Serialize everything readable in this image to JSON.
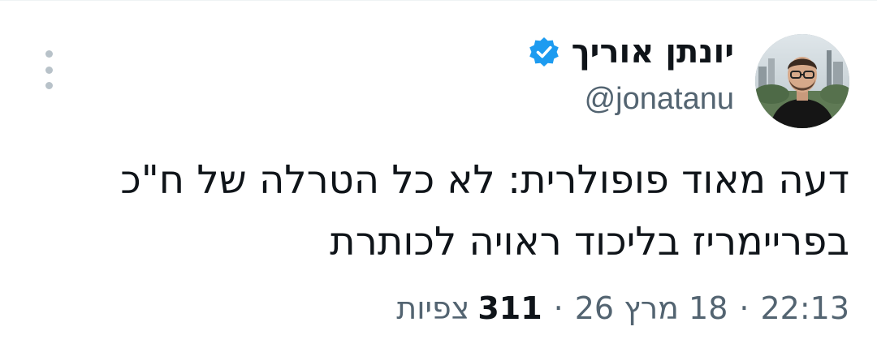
{
  "tweet": {
    "author": {
      "display_name": "יונתן אוריך",
      "handle": "@jonatanu",
      "verified": true,
      "verified_icon": "verified-badge-icon",
      "verified_color": "#1d9bf0",
      "avatar_icon": "profile-photo"
    },
    "more_icon": "more-vertical-icon",
    "text_lines": [
      "דעה מאוד פופולרית: לא כל הטרלה של ח\"כ",
      "בפריימריז בליכוד ראויה לכותרת"
    ],
    "meta": {
      "time": "22:13",
      "date": "18 מרץ 26",
      "views_count": "311",
      "views_label": "צפיות",
      "separator": "·"
    }
  }
}
